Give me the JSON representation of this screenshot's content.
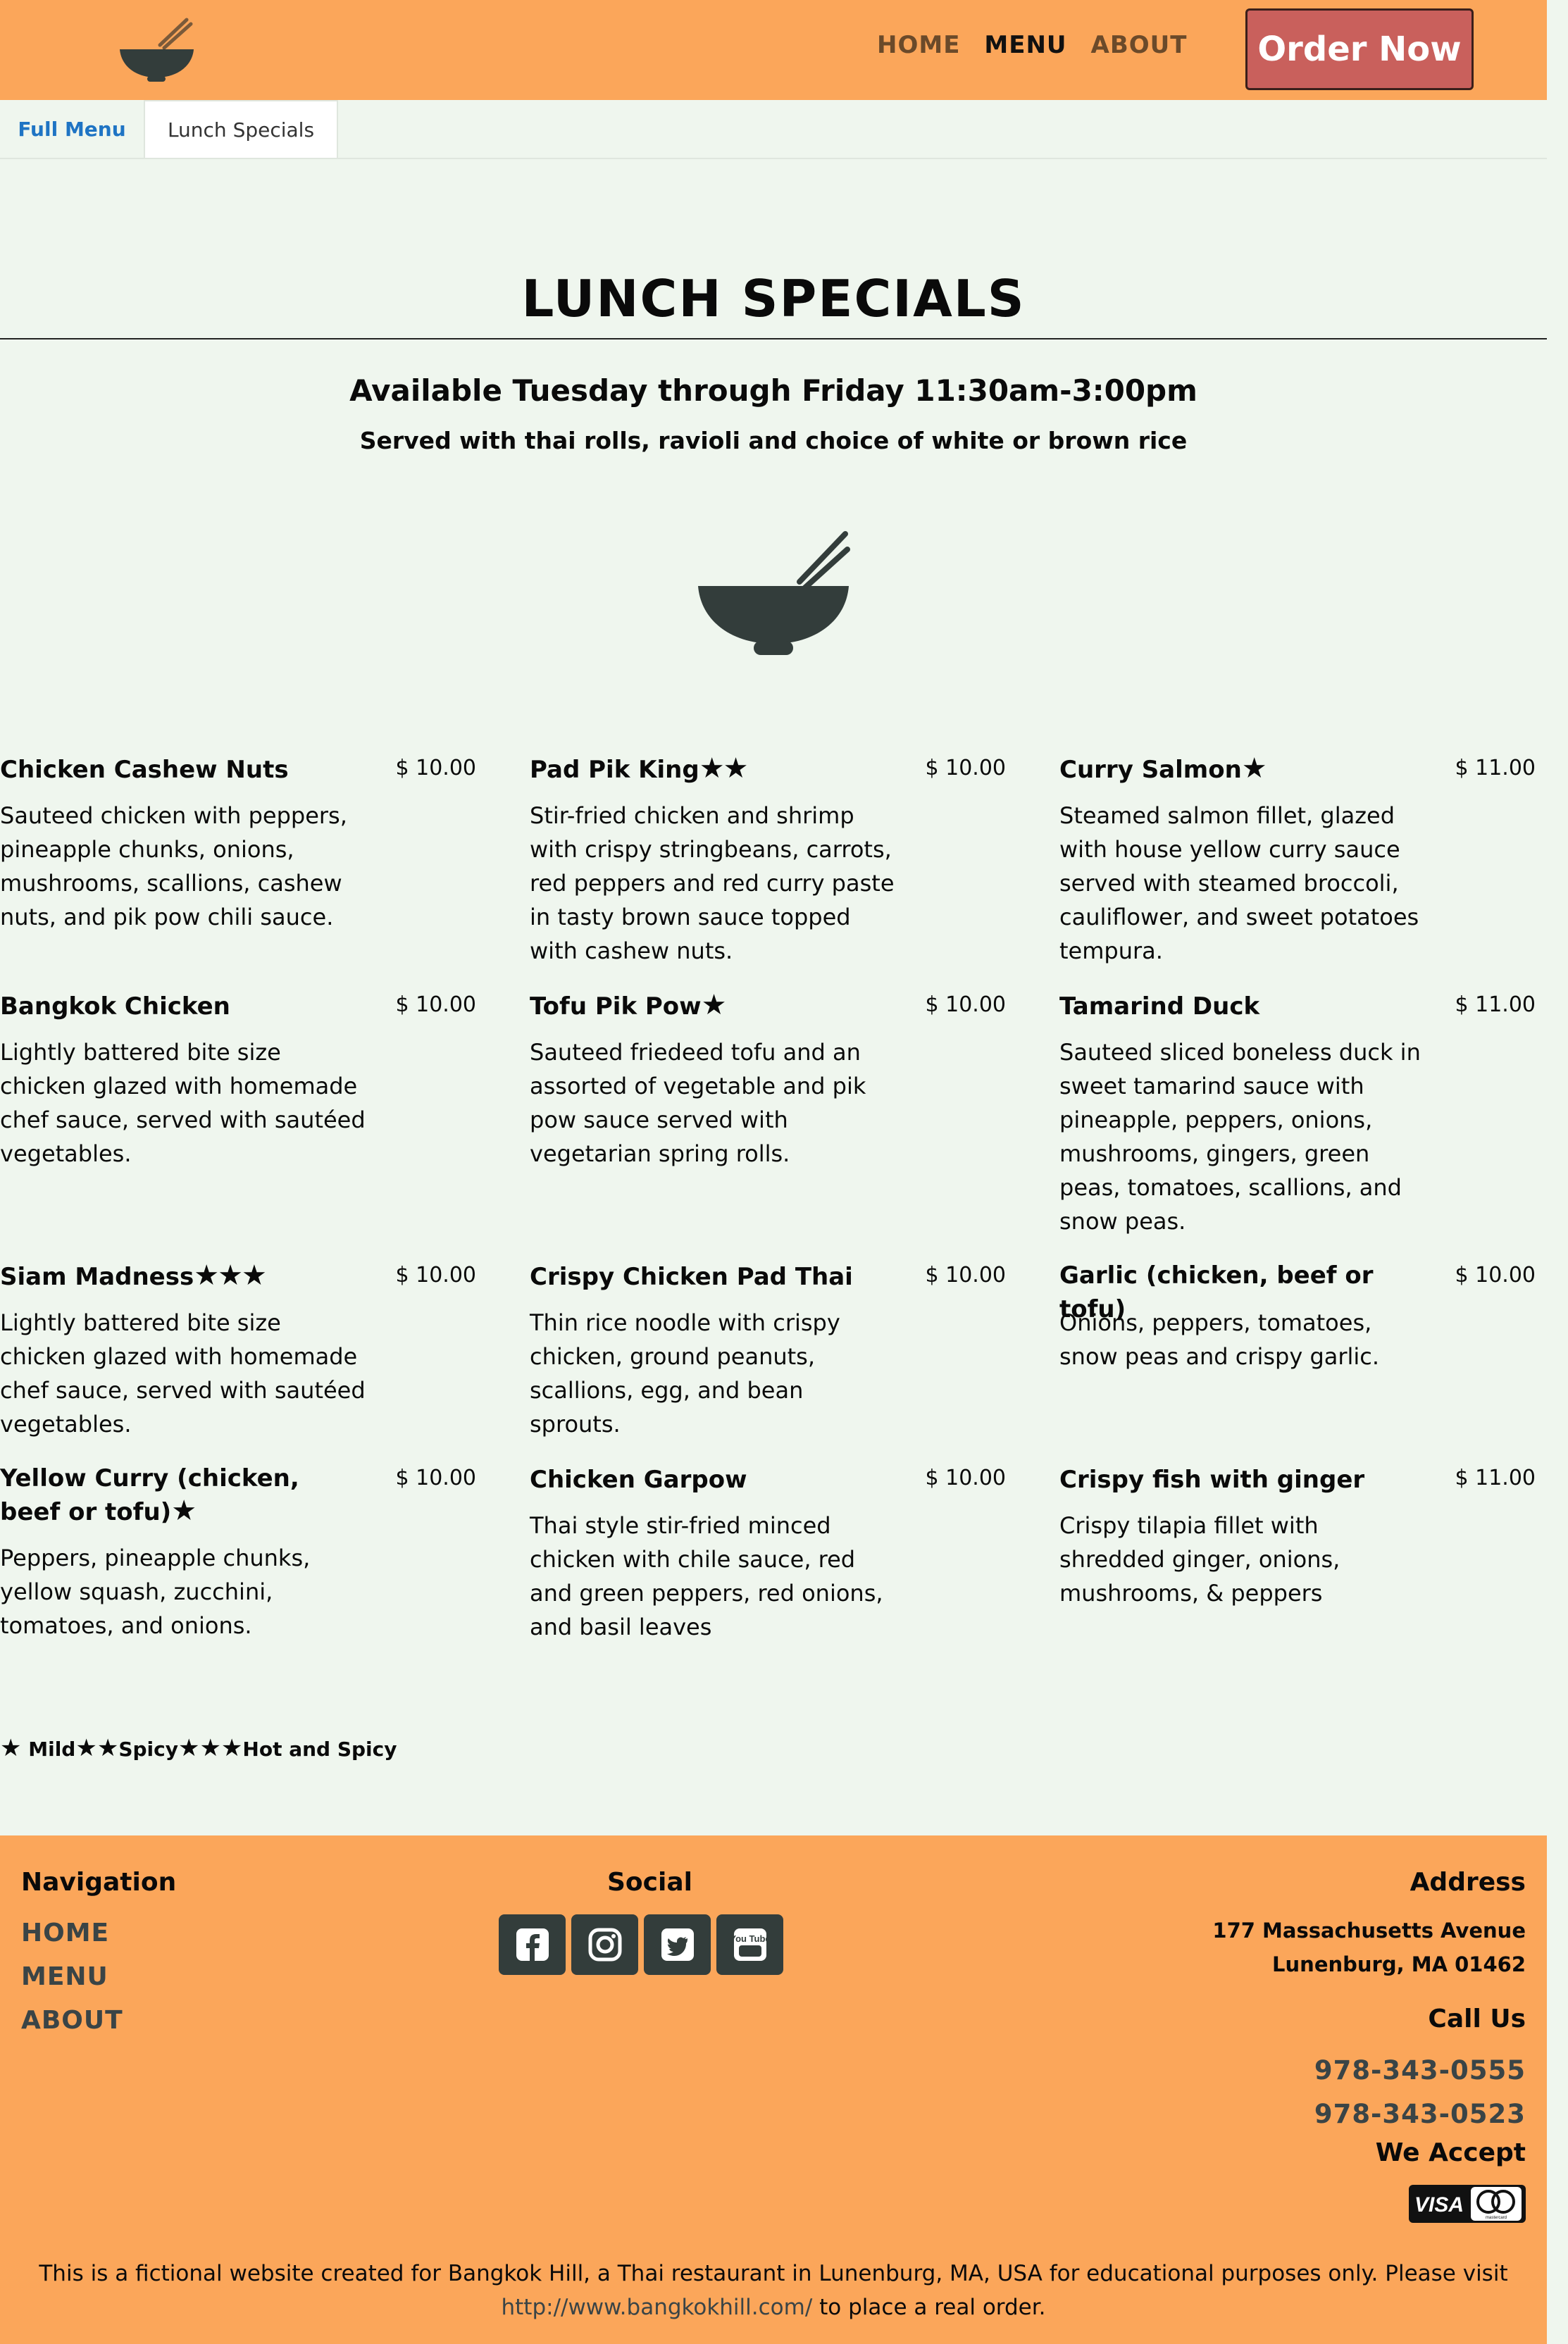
{
  "header": {
    "nav": [
      "HOME",
      "MENU",
      "ABOUT"
    ],
    "order_button": "Order Now"
  },
  "tabs": [
    "Full Menu",
    "Lunch Specials"
  ],
  "page": {
    "title": "LUNCH SPECIALS",
    "availability": "Available Tuesday through Friday 11:30am-3:00pm",
    "served_with": "Served with thai rolls, ravioli and choice of white or brown rice"
  },
  "menu": [
    {
      "name": "Chicken Cashew Nuts",
      "stars": "",
      "price": "$ 10.00",
      "desc": "Sauteed chicken with peppers, pineapple chunks, onions, mushrooms, scallions, cashew nuts, and pik pow chili sauce."
    },
    {
      "name": "Pad Pik King",
      "stars": "★★",
      "price": "$ 10.00",
      "desc": "Stir-fried chicken and shrimp with crispy stringbeans, carrots, red peppers and red curry paste in tasty brown sauce topped with cashew nuts."
    },
    {
      "name": "Curry Salmon",
      "stars": "★",
      "price": "$ 11.00",
      "desc": "Steamed salmon fillet, glazed with house yellow curry sauce served with steamed broccoli, cauliflower, and sweet potatoes tempura."
    },
    {
      "name": "Bangkok Chicken",
      "stars": "",
      "price": "$ 10.00",
      "desc": "Lightly battered bite size chicken glazed with homemade chef sauce, served with sautéed vegetables."
    },
    {
      "name": "Tofu Pik Pow",
      "stars": "★",
      "price": "$ 10.00",
      "desc": "Sauteed friedeed tofu and an assorted of vegetable and pik pow sauce served with vegetarian spring rolls."
    },
    {
      "name": "Tamarind Duck",
      "stars": "",
      "price": "$ 11.00",
      "desc": "Sauteed sliced boneless duck in sweet tamarind sauce with pineapple, peppers, onions, mushrooms, gingers, green peas, tomatoes, scallions, and snow peas."
    },
    {
      "name": "Siam Madness",
      "stars": "★★★",
      "price": "$ 10.00",
      "desc": "Lightly battered bite size chicken glazed with homemade chef sauce, served with sautéed vegetables."
    },
    {
      "name": "Crispy Chicken Pad Thai",
      "stars": "",
      "price": "$ 10.00",
      "desc": "Thin rice noodle with crispy chicken, ground peanuts, scallions, egg, and bean sprouts."
    },
    {
      "name": "Garlic (chicken, beef or tofu)",
      "stars": "",
      "price": "$ 10.00",
      "desc": "Onions, peppers, tomatoes, snow peas and crispy garlic."
    },
    {
      "name": "Yellow Curry (chicken, beef or tofu)",
      "stars": "★",
      "price": "$ 10.00",
      "desc": "Peppers, pineapple chunks, yellow squash, zucchini, tomatoes, and onions."
    },
    {
      "name": "Chicken Garpow",
      "stars": "",
      "price": "$ 10.00",
      "desc": "Thai style stir-fried minced chicken with chile sauce, red and green peppers, red onions, and basil leaves"
    },
    {
      "name": "Crispy fish with ginger",
      "stars": "",
      "price": "$ 11.00",
      "desc": "Crispy tilapia fillet with shredded ginger, onions, mushrooms, & peppers"
    }
  ],
  "legend": {
    "mild_stars": "★",
    "mild": "Mild",
    "spicy_stars": "★★",
    "spicy": "Spicy",
    "hot_stars": "★★★",
    "hot": "Hot and Spicy"
  },
  "footer": {
    "nav_heading": "Navigation",
    "nav_links": [
      "HOME",
      "MENU",
      "ABOUT"
    ],
    "social_heading": "Social",
    "social_icons": [
      "facebook-icon",
      "instagram-icon",
      "twitter-icon",
      "youtube-icon"
    ],
    "youtube_text": "You Tube",
    "address_heading": "Address",
    "address_line1": "177 Massachusetts Avenue",
    "address_line2": "Lunenburg, MA 01462",
    "call_heading": "Call Us",
    "phones": [
      "978-343-0555",
      "978-343-0523"
    ],
    "accept_heading": "We Accept",
    "cards": {
      "visa": "VISA",
      "mastercard": "mastercard"
    },
    "disclaimer_text": "This is a fictional website created for Bangkok Hill, a Thai restaurant in Lunenburg, MA, USA for educational purposes only. Please visit",
    "disclaimer_link": "http://www.bangkokhill.com/",
    "disclaimer_tail": "to place a real order."
  },
  "colors": {
    "header_bg": "#fba65a",
    "page_bg": "#eff6ee",
    "order_button": "#c9605c",
    "icon_dark": "#333d3b",
    "tab_link": "#1f74c4"
  }
}
